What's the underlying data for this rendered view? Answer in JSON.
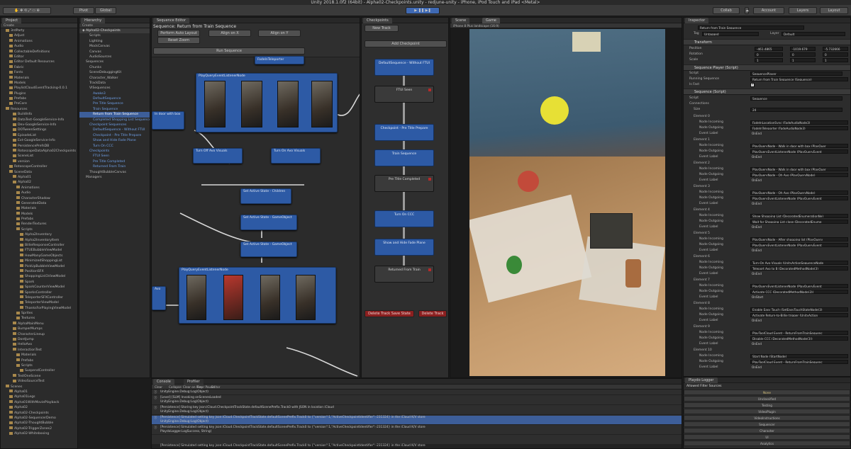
{
  "app": {
    "title": "Unity 2018.1.0f2 (64bit) - Alpha02-Checkpoints.unity - redjune-unity - iPhone, iPod Touch and iPad <Metal>"
  },
  "toolbar": {
    "pivot": "Pivot",
    "global": "Global",
    "collab": "Collab",
    "account": "Account",
    "layers": "Layers",
    "layout": "Layout"
  },
  "project": {
    "tab": "Project",
    "create": "Create",
    "items": [
      "3rdParty",
      "Adjust",
      "Animations",
      "Audio",
      "CollectableDefinitions",
      "Editor",
      "Editor Default Resources",
      "Fabric",
      "Fonts",
      "Materials",
      "Models",
      "PlaylistCloudEventTracking-0.0.1",
      "Plugins",
      "Prefabs",
      "ProCore",
      "Resources",
      "BuildInfo",
      "DataTest-GoogleService-Info",
      "Dev-GoogleService-Info",
      "DOTweenSettings",
      "EpisodeList",
      "Ext-GoogleService-Info",
      "PersistencePrefsDB",
      "RotoscopeDataAlpha02Checkpoints",
      "SceneList",
      "version",
      "RotoscopeController",
      "SceneData",
      "Alpha01",
      "Alpha02",
      "Animations",
      "Audio",
      "CharacterShadow",
      "GeneratedData",
      "Materials",
      "Models",
      "Prefabs",
      "RenderTextures",
      "Scripts",
      "Alpha2Inventory",
      "Alpha2InventoryItem",
      "BillieResponseController",
      "FTUEBubbleViewModel",
      "HowManyGameObjects",
      "MinimizedShoppingList",
      "PickUpBubbleViewModel",
      "PositionSFX",
      "ShoppingList1ViewModel",
      "Spark",
      "SparkCounterViewModel",
      "SparksController",
      "TeleporterSFXController",
      "TeleporterViewModel",
      "ThanksForPlayingViewModel",
      "Sprites",
      "Textures",
      "AlphaMainMenu",
      "BumperMumps",
      "CharacterLineup",
      "DontJump",
      "HelloAvo",
      "InteractionTest",
      "Materials",
      "Prefabs",
      "Scripts",
      "SuspendController",
      "TestOneScene",
      "VideoSourceTest",
      "Scenes",
      "Alpha01",
      "Alpha01Legs",
      "Alpha01WithMoviePlayback",
      "Alpha02",
      "Alpha02-Checkpoints",
      "Alpha02-SequencerDemo",
      "Alpha02-ThoughtBubble",
      "Alpha02-TriggerZones2",
      "Alpha02-Whiteboxing"
    ]
  },
  "hierarchy": {
    "tab": "Hierarchy",
    "create": "Create",
    "scene": "Alpha02-Checkpoints",
    "items": [
      "Scripts",
      "Lighting",
      "MockCanvas",
      "Canvas",
      "AudioSources",
      "Sequences",
      "Chunks",
      "SceneDebuggingKit",
      "Character_Walker",
      "TrackData",
      "VISequences",
      "Awake3",
      "DefaultSequence",
      "Pre Title Sequence",
      "Train Sequence",
      "Return from Train Sequence",
      "Completed Shopping List Sequence",
      "Checkpoint Sequences",
      "DefaultSequence - Without FTUI",
      "Checkpoint - Pre Title Prepare",
      "Show and Hide Fade Plane",
      "Turn On CCC",
      "Checkpoints",
      "FTUI Seen",
      "Pre Title Completed",
      "Returned From Train",
      "ThoughtBubbleCanvas",
      "Managers"
    ],
    "selected": "Return from Train Sequence"
  },
  "sequence_editor": {
    "tab": "Sequence Editor",
    "title": "Sequence: Return from Train Sequence",
    "buttons": [
      "Perform Auto Layout",
      "Align on X",
      "Align on Y",
      "Reset Zoom",
      "Run Sequence"
    ],
    "nodes": [
      "FadeInTeleporter",
      "PlayQueryEventListenerNode",
      "In door with box",
      "Turn Off Avo Visuals",
      "Turn On Avo Visuals",
      "Set Active State - Children",
      "Set Active State - GameObject",
      "Set Active State - GameObject",
      "PlayQueryEventListenerNode",
      "Avo"
    ]
  },
  "checkpoints": {
    "tab": "Checkpoints",
    "new_track": "New Track",
    "add_checkpoint": "Add Checkpoint",
    "items": [
      {
        "label": "DefaultSequence - Without FTUI",
        "style": "blue"
      },
      {
        "label": "FTUI Seen",
        "style": "gray"
      },
      {
        "label": "Checkpoint - Pre Title Prepare",
        "style": "blue"
      },
      {
        "label": "Train Sequence",
        "style": "blue"
      },
      {
        "label": "Pre Title Completed",
        "style": "gray"
      },
      {
        "label": "Turn On CCC",
        "style": "blue"
      },
      {
        "label": "Show and Hide Fade Plane",
        "style": "blue"
      },
      {
        "label": "Returned From Train",
        "style": "gray"
      }
    ],
    "delete_save": "Delete Track Save State",
    "delete_track": "Delete Track"
  },
  "scene": {
    "tab": "Scene",
    "game_tab": "Game",
    "display": "iPhone 8 Plus landscape (16:9)"
  },
  "inspector": {
    "tab": "Inspector",
    "object": "Return from Train Sequence",
    "tag": "Untagged",
    "layer": "Default",
    "transform": "Transform",
    "position": {
      "label": "Position",
      "x": "-461.4865",
      "y": "-1019.679",
      "z": "-5.732666"
    },
    "rotation": {
      "label": "Rotation",
      "x": "0",
      "y": "0",
      "z": "0"
    },
    "scale": {
      "label": "Scale",
      "x": "1",
      "y": "1",
      "z": "1"
    },
    "player": "Sequence Player (Script)",
    "script_label": "Script",
    "script_val": "SequencePlayer",
    "running_label": "Running Sequence",
    "running_val": "Return from Train Sequence (Sequence)",
    "isfast": "Is Fast",
    "seq": "Sequence (Script)",
    "seq_script": "Sequence",
    "connections": "Connections",
    "size_label": "Size",
    "size_val": "24",
    "elements": [
      {
        "name": "Element 0",
        "in": "FadeInLocationSync (FadeAudioNode3)",
        "out": "FadeInTeleporter (FadeAudioNode3)",
        "ev": "OnEnd"
      },
      {
        "name": "Element 1",
        "in": "PlayQueryNode - Walk in door with box (PlayQuer",
        "out": "PlayQueryEventListenerNode (PlayQueryEvent",
        "ev": "OnEnd"
      },
      {
        "name": "Element 2",
        "in": "PlayQueryNode - Walk in door with box (PlayQuer",
        "out": "PlayQueryNode - Oh Avo (PlayQueryNode)",
        "ev": "OnEnd"
      },
      {
        "name": "Element 3",
        "in": "PlayQueryNode - Oh Avo (PlayQueryNode)",
        "out": "PlayQueryEventListenerNode (PlayQueryEvent",
        "ev": "OnEnd"
      },
      {
        "name": "Element 4",
        "in": "Show Shopping List (DecoratedEnumerationNe)",
        "out": "Wait for Shopping List close (DecoratedEnume",
        "ev": "OnEnd"
      },
      {
        "name": "Element 5",
        "in": "PlayQueryNode - After shopping list (PlayQuery",
        "out": "PlayQueryEventListenerNode (PlayQueryEvent",
        "ev": "OnEnd"
      },
      {
        "name": "Element 6",
        "in": "Turn-On Avo Visuals (UnityActionSequenceNode",
        "out": "Teleport Avo to B (DecoratedMethodNode(3)",
        "ev": "OnEnd"
      },
      {
        "name": "Element 7",
        "in": "PlayQueryEventListenerNode (PlayQueryEvent",
        "out": "Activate CCC (DecoratedMethodNode(3))",
        "ev": "OnStart"
      },
      {
        "name": "Element 8",
        "in": "Enable Easy Touch (SetEasyTouchStateNode(3)",
        "out": "Activate Return-to-Billie trigger (UnityAction",
        "ev": "OnEnd"
      },
      {
        "name": "Element 9",
        "in": "PlayToolCloud Event - ReturnFromTrainSequenc",
        "out": "Disable CCC (DecoratedMethodNode(3))",
        "ev": "OnEnd"
      },
      {
        "name": "Element 10",
        "in": "Start Node (StartNode)",
        "out": "PlayToolCloud Event - ReturnFromTrainSequenc",
        "ev": "OnEnd"
      }
    ],
    "node_in": "Node Incoming",
    "node_out": "Node Outgoing",
    "event_label": "Event Label"
  },
  "console": {
    "tab": "Console",
    "profiler_tab": "Profiler",
    "buttons": [
      "Clear",
      "Collapse",
      "Clear on Play",
      "Error Pause",
      "Editor"
    ],
    "lines": [
      "UnityEngine.Debug:Log(Object)",
      "[Level] [SLM] Invoking onScenesLoaded",
      "UnityEngine.Debug:Log(Object)",
      "[Persistence] Storing key json:iCloud.CheckpointTrackState.defaultScenePrefix.Track0 with JSON in location iCloud",
      "UnityEngine.Debug:Log(Object)",
      "[Persistence] Simulated setting key json:iCloud.CheckpointTrackState.defaultScenePrefix.Track0 to {\"version\":1,\"ActiveCheckpointIdentifier\":-231324} in the iCloud K/V store",
      "UnityEngine.Debug:Log(Object)",
      "[Persistence] Simulated setting key json:iCloud.CheckpointTrackState.defaultScenePrefix.Track0 to {\"version\":1,\"ActiveCheckpointIdentifier\":-231324} in the iCloud K/V store",
      "PlaydoLogger.LogSuccess, String)"
    ],
    "status": "[Persistence] Simulated setting key json:iCloud.CheckpointTrackState.defaultScenePrefix.Track0 to {\"version\":1,\"ActiveCheckpointIdentifier\":-231324} in the iCloud K/V store"
  },
  "playdo": {
    "tab": "Playdo Logger",
    "heading": "Allowed Filter Sources",
    "items": [
      "None",
      "Unclassified",
      "Testing",
      "VideoPlugin",
      "VideoInstructions",
      "Sequencer",
      "Character",
      "UI",
      "Analytics"
    ]
  }
}
